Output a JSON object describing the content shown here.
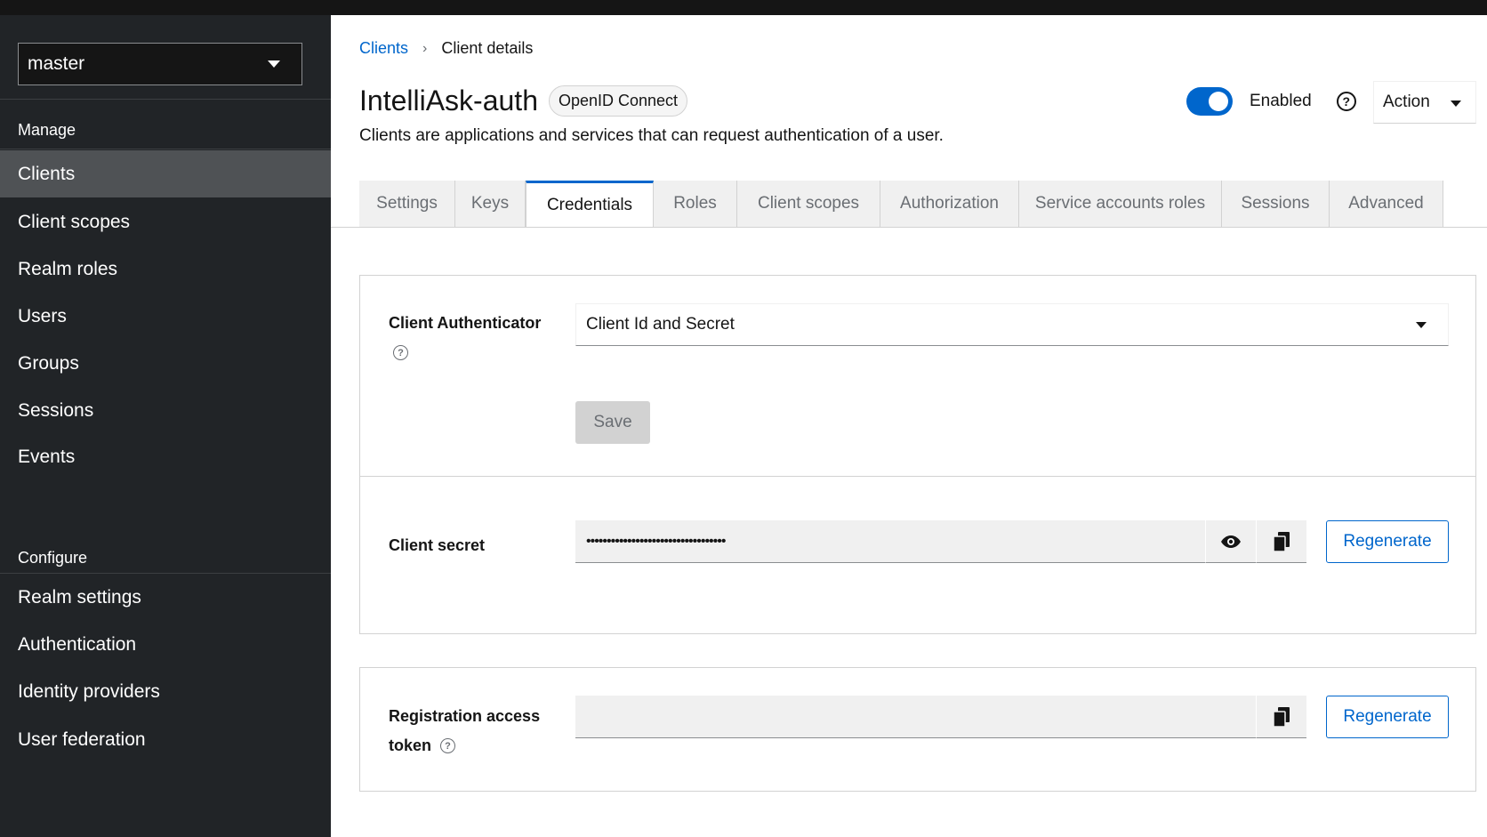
{
  "sidebar": {
    "realm_selector": "master",
    "manage_heading": "Manage",
    "manage_items": [
      "Clients",
      "Client scopes",
      "Realm roles",
      "Users",
      "Groups",
      "Sessions",
      "Events"
    ],
    "configure_heading": "Configure",
    "configure_items": [
      "Realm settings",
      "Authentication",
      "Identity providers",
      "User federation"
    ],
    "active_item": "Clients"
  },
  "breadcrumb": {
    "parent": "Clients",
    "current": "Client details"
  },
  "header": {
    "title": "IntelliAsk-auth",
    "protocol": "OpenID Connect",
    "description": "Clients are applications and services that can request authentication of a user.",
    "enabled_label": "Enabled",
    "enabled": true,
    "action_label": "Action"
  },
  "tabs": [
    {
      "label": "Settings"
    },
    {
      "label": "Keys"
    },
    {
      "label": "Credentials",
      "active": true
    },
    {
      "label": "Roles"
    },
    {
      "label": "Client scopes"
    },
    {
      "label": "Authorization"
    },
    {
      "label": "Service accounts roles"
    },
    {
      "label": "Sessions"
    },
    {
      "label": "Advanced"
    }
  ],
  "credentials": {
    "authenticator_label": "Client Authenticator",
    "authenticator_value": "Client Id and Secret",
    "save_label": "Save",
    "secret_label": "Client secret",
    "secret_masked": "••••••••••••••••••••••••••••••••••",
    "regenerate_label": "Regenerate",
    "token_label_line1": "Registration access",
    "token_label_line2": "token",
    "token_value": ""
  },
  "colors": {
    "primary": "#0066cc",
    "sidebar_bg": "#212427",
    "active_nav": "#4f5255"
  }
}
